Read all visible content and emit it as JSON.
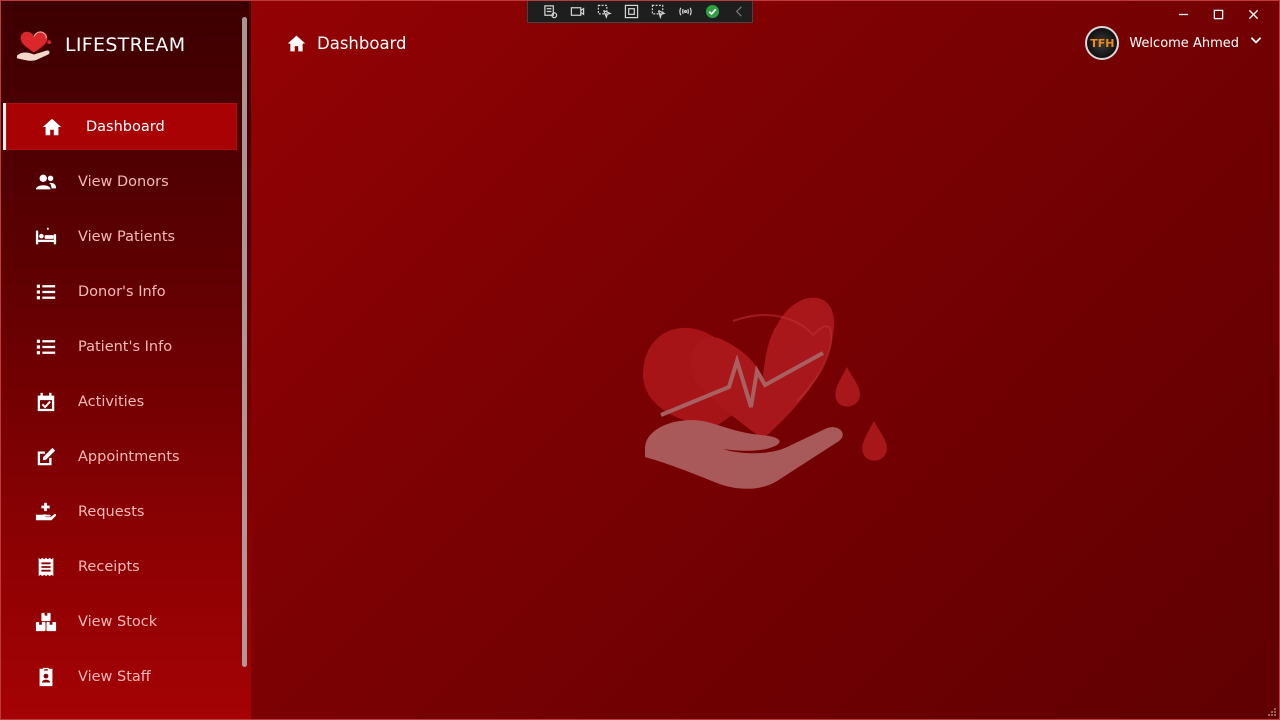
{
  "brand": {
    "name": "LIFESTREAM",
    "logo_icon": "hand-heart-logo-icon"
  },
  "sidebar": {
    "items": [
      {
        "label": "Dashboard",
        "icon": "home-icon",
        "active": true
      },
      {
        "label": "View Donors",
        "icon": "users-icon",
        "active": false
      },
      {
        "label": "View Patients",
        "icon": "hospital-bed-icon",
        "active": false
      },
      {
        "label": "Donor's Info",
        "icon": "list-icon",
        "active": false
      },
      {
        "label": "Patient's Info",
        "icon": "list-icon",
        "active": false
      },
      {
        "label": "Activities",
        "icon": "calendar-check-icon",
        "active": false
      },
      {
        "label": "Appointments",
        "icon": "edit-icon",
        "active": false
      },
      {
        "label": "Requests",
        "icon": "hand-medical-icon",
        "active": false
      },
      {
        "label": "Receipts",
        "icon": "receipt-icon",
        "active": false
      },
      {
        "label": "View Stock",
        "icon": "boxes-icon",
        "active": false
      },
      {
        "label": "View Staff",
        "icon": "id-badge-icon",
        "active": false
      }
    ]
  },
  "header": {
    "title": "Dashboard",
    "title_icon": "home-icon",
    "welcome": "Welcome Ahmed",
    "avatar_text": "TFH"
  },
  "colors": {
    "accent": "#a80205",
    "background_dark": "#5f0002",
    "nav_text": "#f6b9b9"
  }
}
